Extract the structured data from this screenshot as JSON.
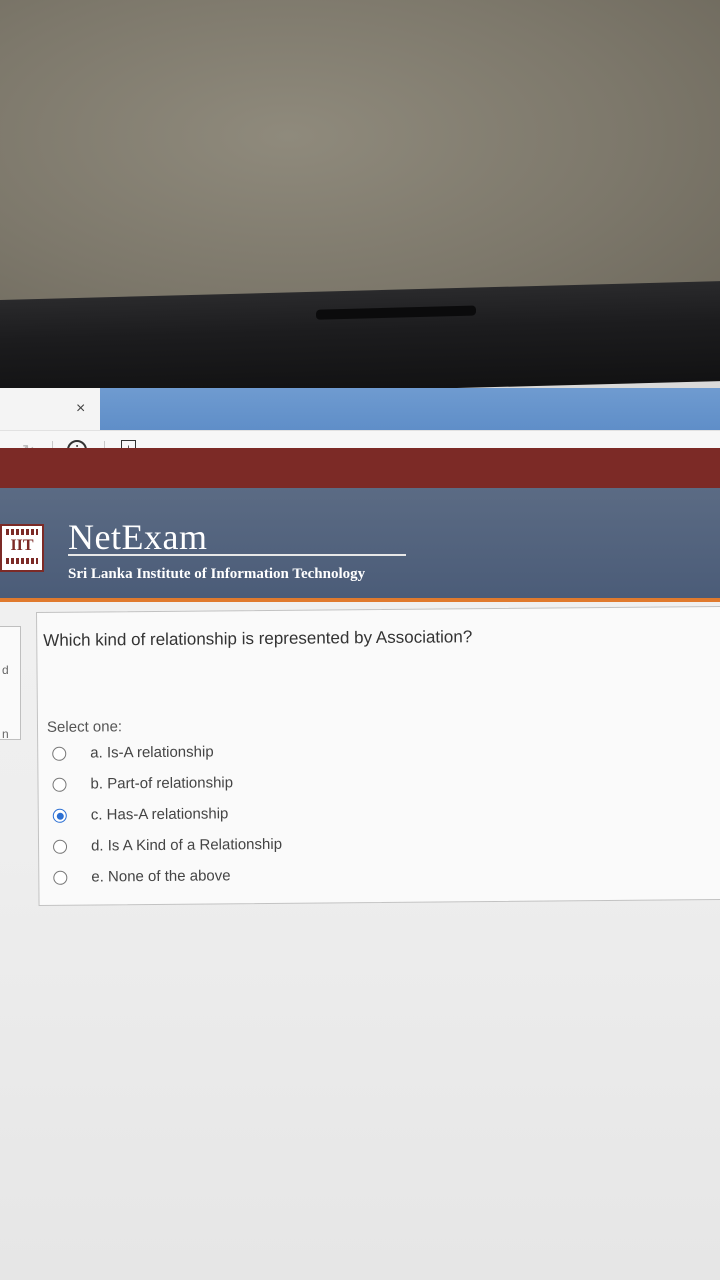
{
  "browser": {
    "tab_close": "×",
    "refresh_icon": "reload-icon",
    "info_icon": "i",
    "page_icon": "+"
  },
  "header": {
    "brand": "NetExam",
    "subtitle": "Sri Lanka Institute of Information Technology",
    "logo_text": "IIT"
  },
  "sidebar_fragments": [
    "d",
    "n"
  ],
  "question": {
    "text": "Which kind of relationship is represented by Association?",
    "prompt": "Select one:",
    "options": [
      {
        "label": "a.  Is-A relationship",
        "selected": false
      },
      {
        "label": "b. Part-of relationship",
        "selected": false
      },
      {
        "label": "c. Has-A relationship",
        "selected": true
      },
      {
        "label": "d. Is A Kind of a Relationship",
        "selected": false
      },
      {
        "label": "e. None of the above",
        "selected": false
      }
    ]
  },
  "colors": {
    "header_bg": "#4b5c78",
    "maroon": "#7c2a26",
    "accent_orange": "#e07a2e",
    "radio_selected": "#2b6fd3"
  }
}
